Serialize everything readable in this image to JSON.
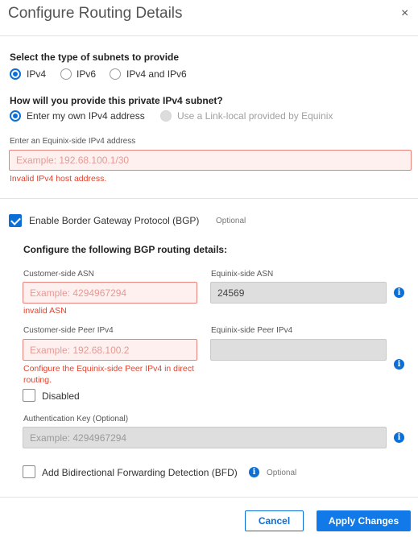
{
  "dialog": {
    "title": "Configure Routing Details",
    "close_label": "×"
  },
  "subnet_type": {
    "label": "Select the type of subnets to provide",
    "options": [
      "IPv4",
      "IPv6",
      "IPv4 and IPv6"
    ],
    "selected": "IPv4"
  },
  "provide_subnet": {
    "label": "How will you provide this private IPv4 subnet?",
    "options": [
      "Enter my own IPv4 address",
      "Use a Link-local provided by Equinix"
    ],
    "selected": "Enter my own IPv4 address"
  },
  "equinix_ipv4": {
    "label": "Enter an Equinix-side IPv4 address",
    "placeholder": "Example: 192.68.100.1/30",
    "error": "Invalid IPv4 host address."
  },
  "bgp": {
    "enable_label": "Enable Border Gateway Protocol (BGP)",
    "optional_label": "Optional",
    "checked": true,
    "section_title": "Configure the following BGP routing details:",
    "customer_asn": {
      "label": "Customer-side ASN",
      "placeholder": "Example: 4294967294",
      "error": "invalid ASN"
    },
    "equinix_asn": {
      "label": "Equinix-side ASN",
      "value": "24569"
    },
    "customer_peer": {
      "label": "Customer-side Peer IPv4",
      "placeholder": "Example: 192.68.100.2",
      "error": "Configure the Equinix-side Peer IPv4 in direct routing."
    },
    "equinix_peer": {
      "label": "Equinix-side Peer IPv4",
      "value": ""
    },
    "disabled_label": "Disabled",
    "auth_key": {
      "label": "Authentication Key (Optional)",
      "placeholder": "Example: 4294967294"
    }
  },
  "bfd": {
    "label": "Add Bidirectional Forwarding Detection (BFD)",
    "optional_label": "Optional"
  },
  "footer": {
    "cancel_label": "Cancel",
    "apply_label": "Apply Changes"
  },
  "colors": {
    "accent": "#0b6fd6",
    "error": "#e0432f",
    "error_field_bg": "#fdf0ef"
  },
  "icons": [
    "close-icon",
    "info-icon",
    "check-icon"
  ]
}
